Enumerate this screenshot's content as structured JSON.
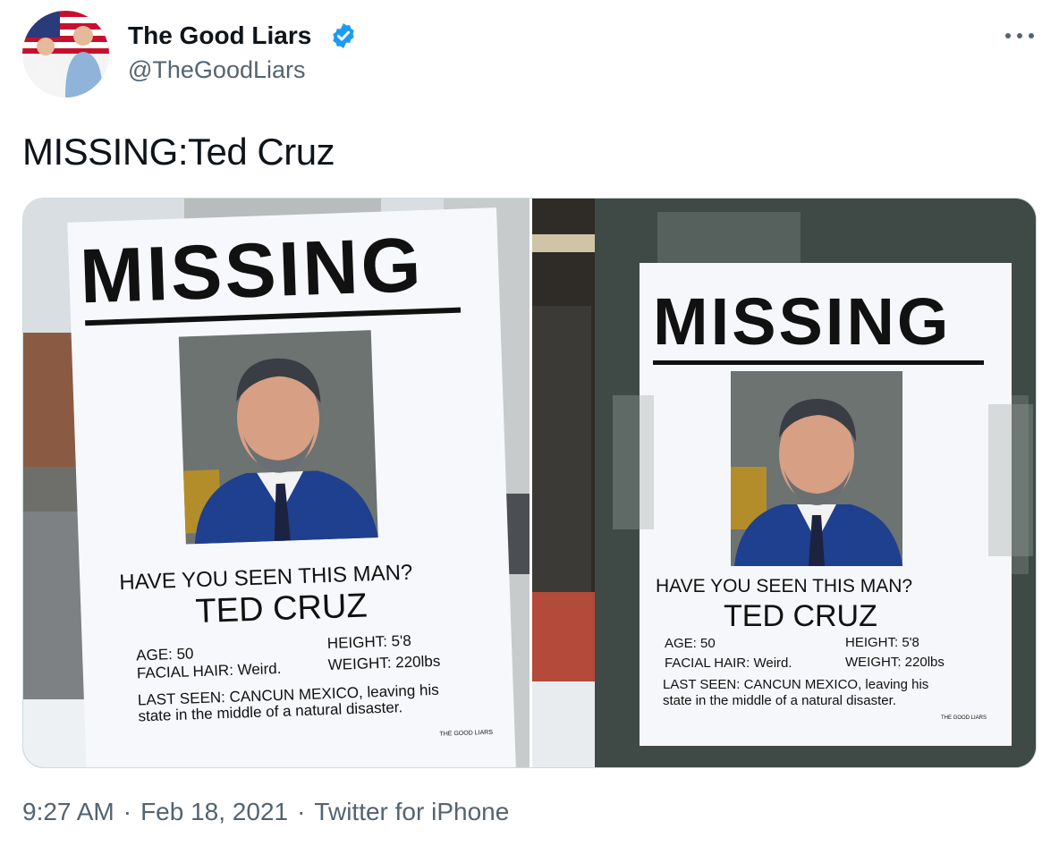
{
  "author": {
    "name": "The Good Liars",
    "handle": "@TheGoodLiars",
    "verified": true
  },
  "tweet": {
    "text": "MISSING:Ted Cruz"
  },
  "poster": {
    "headline": "MISSING",
    "question": "HAVE YOU SEEN THIS MAN?",
    "name": "TED CRUZ",
    "age": "AGE: 50",
    "height": "HEIGHT: 5'8",
    "facial_hair": "FACIAL HAIR: Weird.",
    "weight": "WEIGHT: 220lbs",
    "last_seen_line1": "LAST SEEN: CANCUN MEXICO, leaving his",
    "last_seen_line2": "state in the middle of a natural disaster.",
    "credit": "THE GOOD LIARS"
  },
  "meta": {
    "time": "9:27 AM",
    "date": "Feb 18, 2021",
    "source": "Twitter for iPhone",
    "separator": "·"
  },
  "colors": {
    "verified_blue": "#1d9bf0",
    "secondary_text": "#536471",
    "suit_blue": "#1f3f8f"
  },
  "icons": {
    "verified": "verified-badge-icon",
    "more": "more-horizontal-icon"
  }
}
